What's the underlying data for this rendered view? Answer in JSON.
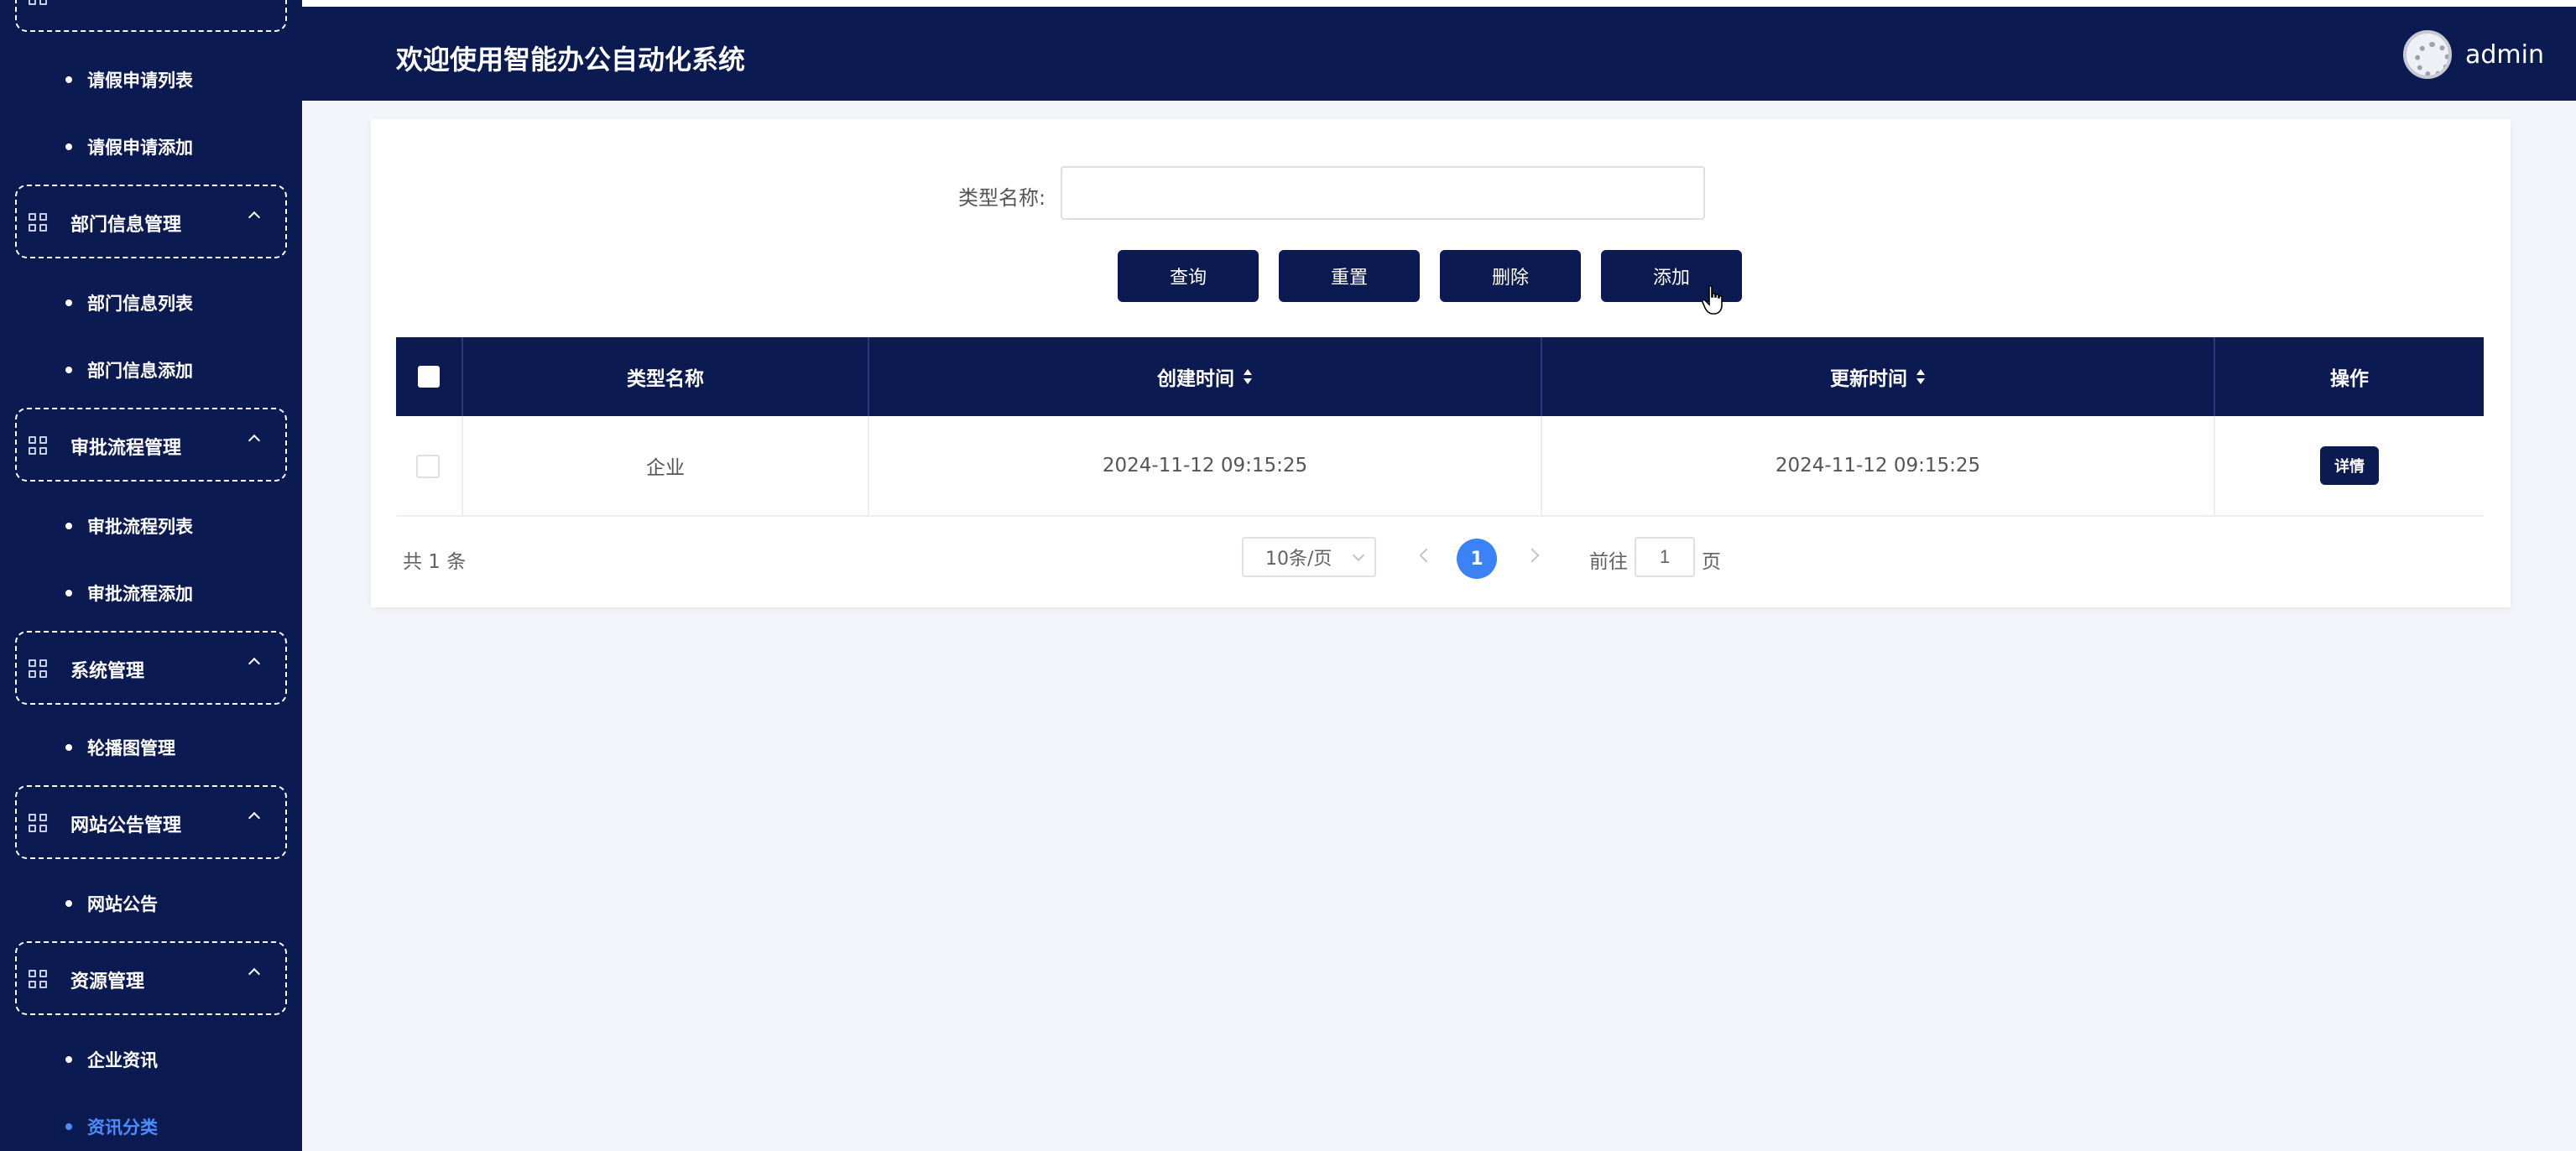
{
  "app": {
    "title": "欢迎使用智能办公自动化系统",
    "user": "admin"
  },
  "sidebar": {
    "groups": [
      {
        "label": "部门信息管理",
        "items": [
          "部门信息列表",
          "部门信息添加"
        ]
      },
      {
        "label": "审批流程管理",
        "items": [
          "审批流程列表",
          "审批流程添加"
        ]
      },
      {
        "label": "系统管理",
        "items": [
          "轮播图管理"
        ]
      },
      {
        "label": "网站公告管理",
        "items": [
          "网站公告"
        ]
      },
      {
        "label": "资源管理",
        "items": [
          "企业资讯",
          "资讯分类"
        ]
      }
    ],
    "top_items": [
      "请假申请列表",
      "请假申请添加"
    ],
    "active_item": "资讯分类"
  },
  "search": {
    "label": "类型名称:",
    "value": "",
    "placeholder": ""
  },
  "toolbar": {
    "query_label": "查询",
    "reset_label": "重置",
    "delete_label": "删除",
    "add_label": "添加"
  },
  "table": {
    "columns": [
      "类型名称",
      "创建时间",
      "更新时间",
      "操作"
    ],
    "rows": [
      {
        "name": "企业",
        "created": "2024-11-12 09:15:25",
        "updated": "2024-11-12 09:15:25",
        "action": "详情"
      }
    ]
  },
  "pagination": {
    "total_text": "共 1 条",
    "page_size": "10条/页",
    "current_page": "1",
    "goto_label": "前往",
    "goto_value": "1",
    "goto_suffix": "页"
  },
  "colors": {
    "primary": "#0c1a52",
    "active_link": "#4b8dff",
    "page_current": "#3b82f6",
    "background": "#f4f5fa"
  }
}
